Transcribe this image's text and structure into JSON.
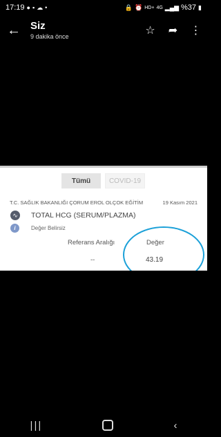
{
  "status": {
    "time": "17:19",
    "network": "HD+",
    "network_gen": "4G",
    "battery": "%37"
  },
  "header": {
    "title": "Siz",
    "subtitle": "9 dakika önce"
  },
  "report": {
    "tabs": [
      {
        "label": "Tümü"
      },
      {
        "label": "COVID-19"
      }
    ],
    "hospital": "T.C. SAĞLIK BAKANLIĞI ÇORUM EROL OLÇOK EĞİTİM",
    "date": "19 Kasım 2021",
    "test_name": "TOTAL HCG (SERUM/PLAZMA)",
    "info": "Değer Belirsiz",
    "columns": {
      "reference": "Referans Aralığı",
      "value": "Değer"
    },
    "reference_value": "--",
    "result_value": "43.19"
  },
  "colors": {
    "annotation": "#1ba0d8",
    "background": "#000000"
  },
  "icons": {
    "back": "back-arrow-icon",
    "star": "star-icon",
    "share": "share-icon",
    "more": "more-vert-icon"
  }
}
